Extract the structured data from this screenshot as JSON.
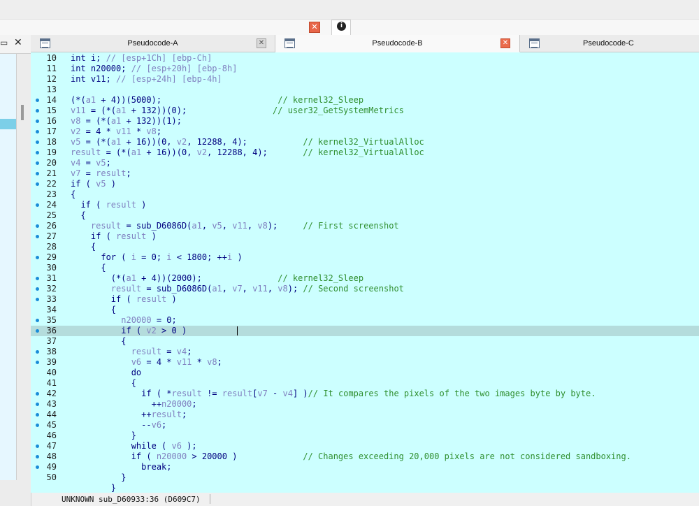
{
  "window": {
    "top_close_icon": "close-icon",
    "info_icon": "info-icon",
    "left_panel": {
      "restore_icon": "restore-window-icon",
      "close_label": "✕"
    }
  },
  "tabs": [
    {
      "label": "Pseudocode-A",
      "icon": "pseudocode-icon",
      "close_style": "grey"
    },
    {
      "label": "Pseudocode-B",
      "icon": "pseudocode-icon",
      "close_style": "red",
      "active": true
    },
    {
      "label": "Pseudocode-C",
      "icon": "pseudocode-icon"
    }
  ],
  "code_lines": [
    {
      "n": "10",
      "dot": false,
      "code": [
        [
          "int i; ",
          "txt"
        ],
        [
          "// [esp+1Ch] [ebp-Ch]",
          "var"
        ]
      ]
    },
    {
      "n": "11",
      "dot": false,
      "code": [
        [
          "int n20000; ",
          "txt"
        ],
        [
          "// [esp+20h] [ebp-8h]",
          "var"
        ]
      ]
    },
    {
      "n": "12",
      "dot": false,
      "code": [
        [
          "int v11; ",
          "txt"
        ],
        [
          "// [esp+24h] [ebp-4h]",
          "var"
        ]
      ]
    },
    {
      "n": "13",
      "dot": false,
      "code": []
    },
    {
      "n": "14",
      "dot": true,
      "code": [
        [
          "(*(",
          "txt"
        ],
        [
          "a1",
          "var"
        ],
        [
          " + 4))(5000);                       ",
          "txt"
        ],
        [
          "// kernel32_Sleep",
          "cmt"
        ]
      ]
    },
    {
      "n": "15",
      "dot": true,
      "code": [
        [
          "v11",
          "var"
        ],
        [
          " = (*(",
          "txt"
        ],
        [
          "a1",
          "var"
        ],
        [
          " + 132))(0);                 ",
          "txt"
        ],
        [
          "// user32_GetSystemMetrics",
          "cmt"
        ]
      ]
    },
    {
      "n": "16",
      "dot": true,
      "code": [
        [
          "v8",
          "var"
        ],
        [
          " = (*(",
          "txt"
        ],
        [
          "a1",
          "var"
        ],
        [
          " + 132))(1);",
          "txt"
        ]
      ]
    },
    {
      "n": "17",
      "dot": true,
      "code": [
        [
          "v2",
          "var"
        ],
        [
          " = 4 * ",
          "txt"
        ],
        [
          "v11",
          "var"
        ],
        [
          " * ",
          "txt"
        ],
        [
          "v8",
          "var"
        ],
        [
          ";",
          "txt"
        ]
      ]
    },
    {
      "n": "18",
      "dot": true,
      "code": [
        [
          "v5",
          "var"
        ],
        [
          " = (*(",
          "txt"
        ],
        [
          "a1",
          "var"
        ],
        [
          " + 16))(0, ",
          "txt"
        ],
        [
          "v2",
          "var"
        ],
        [
          ", 12288, 4);           ",
          "txt"
        ],
        [
          "// kernel32_VirtualAlloc",
          "cmt"
        ]
      ]
    },
    {
      "n": "19",
      "dot": true,
      "code": [
        [
          "result",
          "var"
        ],
        [
          " = (*(",
          "txt"
        ],
        [
          "a1",
          "var"
        ],
        [
          " + 16))(0, ",
          "txt"
        ],
        [
          "v2",
          "var"
        ],
        [
          ", 12288, 4);       ",
          "txt"
        ],
        [
          "// kernel32_VirtualAlloc",
          "cmt"
        ]
      ]
    },
    {
      "n": "20",
      "dot": true,
      "code": [
        [
          "v4",
          "var"
        ],
        [
          " = ",
          "txt"
        ],
        [
          "v5",
          "var"
        ],
        [
          ";",
          "txt"
        ]
      ]
    },
    {
      "n": "21",
      "dot": true,
      "code": [
        [
          "v7",
          "var"
        ],
        [
          " = ",
          "txt"
        ],
        [
          "result",
          "var"
        ],
        [
          ";",
          "txt"
        ]
      ]
    },
    {
      "n": "22",
      "dot": true,
      "code": [
        [
          "if ( ",
          "txt"
        ],
        [
          "v5",
          "var"
        ],
        [
          " )",
          "txt"
        ]
      ]
    },
    {
      "n": "23",
      "dot": false,
      "code": [
        [
          "{",
          "txt"
        ]
      ]
    },
    {
      "n": "24",
      "dot": true,
      "code": [
        [
          "  if ( ",
          "txt"
        ],
        [
          "result",
          "var"
        ],
        [
          " )",
          "txt"
        ]
      ]
    },
    {
      "n": "25",
      "dot": false,
      "code": [
        [
          "  {",
          "txt"
        ]
      ]
    },
    {
      "n": "26",
      "dot": true,
      "code": [
        [
          "    result",
          "var"
        ],
        [
          " = sub_D6086D(",
          "txt"
        ],
        [
          "a1",
          "var"
        ],
        [
          ", ",
          "txt"
        ],
        [
          "v5",
          "var"
        ],
        [
          ", ",
          "txt"
        ],
        [
          "v11",
          "var"
        ],
        [
          ", ",
          "txt"
        ],
        [
          "v8",
          "var"
        ],
        [
          ");     ",
          "txt"
        ],
        [
          "// First screenshot",
          "cmt"
        ]
      ]
    },
    {
      "n": "27",
      "dot": true,
      "code": [
        [
          "    if ( ",
          "txt"
        ],
        [
          "result",
          "var"
        ],
        [
          " )",
          "txt"
        ]
      ]
    },
    {
      "n": "28",
      "dot": false,
      "code": [
        [
          "    {",
          "txt"
        ]
      ]
    },
    {
      "n": "29",
      "dot": true,
      "code": [
        [
          "      for ( ",
          "txt"
        ],
        [
          "i",
          "var"
        ],
        [
          " = 0; ",
          "txt"
        ],
        [
          "i",
          "var"
        ],
        [
          " < 1800; ++",
          "txt"
        ],
        [
          "i",
          "var"
        ],
        [
          " )",
          "txt"
        ]
      ]
    },
    {
      "n": "30",
      "dot": false,
      "code": [
        [
          "      {",
          "txt"
        ]
      ]
    },
    {
      "n": "31",
      "dot": true,
      "code": [
        [
          "        (*(",
          "txt"
        ],
        [
          "a1",
          "var"
        ],
        [
          " + 4))(2000);               ",
          "txt"
        ],
        [
          "// kernel32_Sleep",
          "cmt"
        ]
      ]
    },
    {
      "n": "32",
      "dot": true,
      "code": [
        [
          "        result",
          "var"
        ],
        [
          " = sub_D6086D(",
          "txt"
        ],
        [
          "a1",
          "var"
        ],
        [
          ", ",
          "txt"
        ],
        [
          "v7",
          "var"
        ],
        [
          ", ",
          "txt"
        ],
        [
          "v11",
          "var"
        ],
        [
          ", ",
          "txt"
        ],
        [
          "v8",
          "var"
        ],
        [
          "); ",
          "txt"
        ],
        [
          "// Second screenshot",
          "cmt"
        ]
      ]
    },
    {
      "n": "33",
      "dot": true,
      "code": [
        [
          "        if ( ",
          "txt"
        ],
        [
          "result",
          "var"
        ],
        [
          " )",
          "txt"
        ]
      ]
    },
    {
      "n": "34",
      "dot": false,
      "code": [
        [
          "        {",
          "txt"
        ]
      ]
    },
    {
      "n": "35",
      "dot": true,
      "code": [
        [
          "          n20000",
          "var"
        ],
        [
          " = 0;",
          "txt"
        ]
      ]
    },
    {
      "n": "36",
      "dot": true,
      "hl": true,
      "code": [
        [
          "          if ( ",
          "txt"
        ],
        [
          "v2",
          "var"
        ],
        [
          " > 0 )",
          "txt"
        ]
      ]
    },
    {
      "n": "37",
      "dot": false,
      "code": [
        [
          "          {",
          "txt"
        ]
      ]
    },
    {
      "n": "38",
      "dot": true,
      "code": [
        [
          "            result",
          "var"
        ],
        [
          " = ",
          "txt"
        ],
        [
          "v4",
          "var"
        ],
        [
          ";",
          "txt"
        ]
      ]
    },
    {
      "n": "39",
      "dot": true,
      "code": [
        [
          "            v6",
          "var"
        ],
        [
          " = 4 * ",
          "txt"
        ],
        [
          "v11",
          "var"
        ],
        [
          " * ",
          "txt"
        ],
        [
          "v8",
          "var"
        ],
        [
          ";",
          "txt"
        ]
      ]
    },
    {
      "n": "40",
      "dot": false,
      "code": [
        [
          "            do",
          "txt"
        ]
      ]
    },
    {
      "n": "41",
      "dot": false,
      "code": [
        [
          "            {",
          "txt"
        ]
      ]
    },
    {
      "n": "42",
      "dot": true,
      "code": [
        [
          "              if ( *",
          "txt"
        ],
        [
          "result",
          "var"
        ],
        [
          " != ",
          "txt"
        ],
        [
          "result",
          "var"
        ],
        [
          "[",
          "txt"
        ],
        [
          "v7",
          "var"
        ],
        [
          " - ",
          "txt"
        ],
        [
          "v4",
          "var"
        ],
        [
          "] )",
          "txt"
        ],
        [
          "// It compares the pixels of the two images byte by byte.",
          "cmt"
        ]
      ]
    },
    {
      "n": "43",
      "dot": true,
      "code": [
        [
          "                ++",
          "txt"
        ],
        [
          "n20000",
          "var"
        ],
        [
          ";",
          "txt"
        ]
      ]
    },
    {
      "n": "44",
      "dot": true,
      "code": [
        [
          "              ++",
          "txt"
        ],
        [
          "result",
          "var"
        ],
        [
          ";",
          "txt"
        ]
      ]
    },
    {
      "n": "45",
      "dot": true,
      "code": [
        [
          "              --",
          "txt"
        ],
        [
          "v6",
          "var"
        ],
        [
          ";",
          "txt"
        ]
      ]
    },
    {
      "n": "46",
      "dot": false,
      "code": [
        [
          "            }",
          "txt"
        ]
      ]
    },
    {
      "n": "47",
      "dot": true,
      "code": [
        [
          "            while ( ",
          "txt"
        ],
        [
          "v6",
          "var"
        ],
        [
          " );",
          "txt"
        ]
      ]
    },
    {
      "n": "48",
      "dot": true,
      "code": [
        [
          "            if ( ",
          "txt"
        ],
        [
          "n20000",
          "var"
        ],
        [
          " > 20000 )             ",
          "txt"
        ],
        [
          "// Changes exceeding 20,000 pixels are not considered sandboxing.",
          "cmt"
        ]
      ]
    },
    {
      "n": "49",
      "dot": true,
      "code": [
        [
          "              break;",
          "txt"
        ]
      ]
    },
    {
      "n": "50",
      "dot": false,
      "code": [
        [
          "          }",
          "txt"
        ]
      ]
    },
    {
      "n": "",
      "dot": false,
      "code": [
        [
          "        }",
          "txt"
        ]
      ]
    }
  ],
  "status_bar": {
    "text": "UNKNOWN sub_D60933:36 (D609C7)"
  }
}
